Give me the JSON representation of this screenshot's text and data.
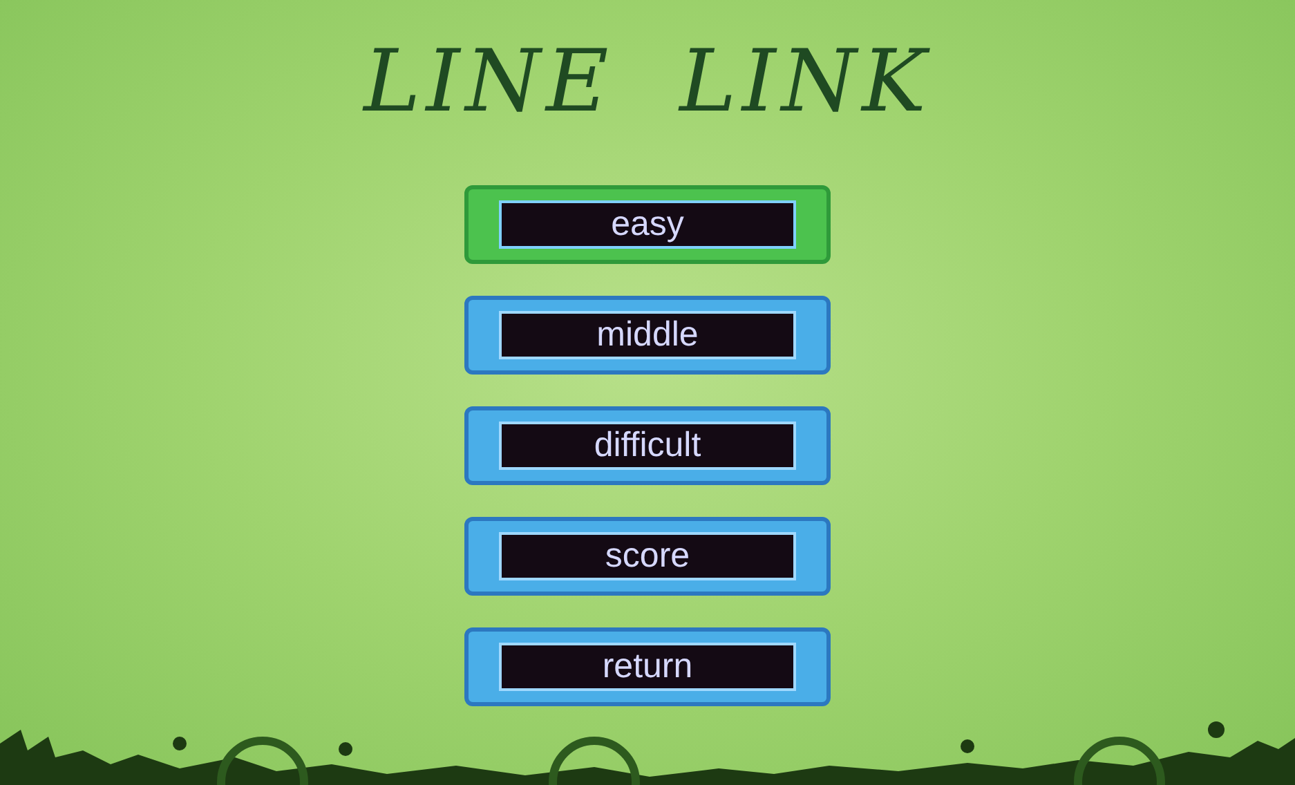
{
  "title": "LINE  LINK",
  "menu": [
    {
      "label": "easy",
      "selected": true
    },
    {
      "label": "middle",
      "selected": false
    },
    {
      "label": "difficult",
      "selected": false
    },
    {
      "label": "score",
      "selected": false
    },
    {
      "label": "return",
      "selected": false
    }
  ]
}
